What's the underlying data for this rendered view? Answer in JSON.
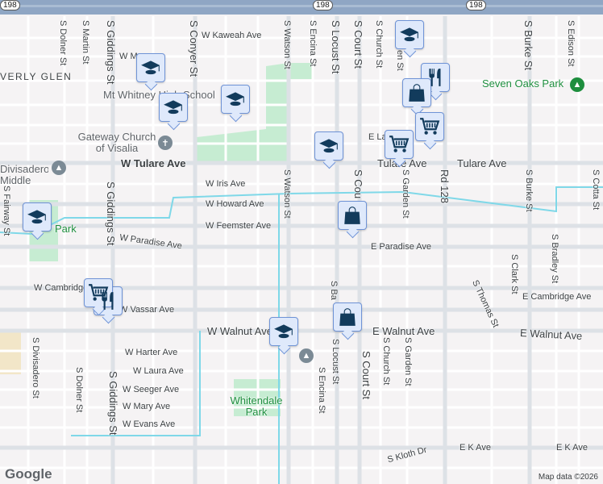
{
  "highway": "198",
  "areas": [
    "VERLY GLEN"
  ],
  "streets": {
    "horizontal": [
      "W Kaweah Ave",
      "W M",
      "W Tulare Ave",
      "Tulare Ave",
      "Tulare Ave",
      "W Iris Ave",
      "W Howard Ave",
      "W Feemster Ave",
      "W Paradise Ave",
      "E Paradise Ave",
      "W Cambridge",
      "W Vassar Ave",
      "E Cambridge Ave",
      "W Walnut Ave",
      "E Walnut Ave",
      "E Walnut Ave",
      "W Harter Ave",
      "W Laura Ave",
      "W Seeger Ave",
      "W Mary Ave",
      "W Evans Ave",
      "E K Ave",
      "E K Ave",
      "E La",
      "S Kloth Dr"
    ],
    "vertical": [
      "S Dolner St",
      "S Martin St",
      "S Giddings St",
      "S Conyer St",
      "S Watson St",
      "S Encina St",
      "S Locust St",
      "S Court St",
      "S Church St",
      "en St",
      "S Burke St",
      "S Edison St",
      "S Cou",
      "S Garden St",
      "Rd 128",
      "S Burke St",
      "S Cotta St",
      "S Fairway St",
      "S Giddings St",
      "S Watson St",
      "S Bradley St",
      "S Clark St",
      "S Thomas St",
      "S Ba",
      "S Locust St",
      "S Church St",
      "S Garden St",
      "S Divisadero St",
      "S Dolner St",
      "S Giddings St",
      "S Encina St",
      "S Court St"
    ]
  },
  "pois": {
    "mt_whitney": "Mt Whitney High School",
    "gateway_church": "Gateway Church of Visalia",
    "divisadero": "Divisadero Middle School",
    "seven_oaks": "Seven Oaks Park",
    "whitendale": "Whitendale Park",
    "park_left": "Park"
  },
  "markers": [
    {
      "type": "school-icon"
    },
    {
      "type": "school-icon"
    },
    {
      "type": "school-icon"
    },
    {
      "type": "school-icon"
    },
    {
      "type": "school-icon"
    },
    {
      "type": "school-icon"
    },
    {
      "type": "school-icon"
    },
    {
      "type": "restaurant-icon"
    },
    {
      "type": "restaurant-icon"
    },
    {
      "type": "shopping-bag-icon"
    },
    {
      "type": "shopping-bag-icon"
    },
    {
      "type": "shopping-bag-icon"
    },
    {
      "type": "grocery-cart-icon"
    },
    {
      "type": "grocery-cart-icon"
    },
    {
      "type": "grocery-cart-icon"
    }
  ],
  "footer": {
    "logo": "Google",
    "attribution": "Map data ©2026"
  },
  "colors": {
    "marker_fill": "#dfe9fb",
    "marker_border": "#6f93d6",
    "icon": "#123b5c",
    "park": "#c6ecd2",
    "water": "#7fd8e8",
    "highway": "#8fa6c4"
  }
}
